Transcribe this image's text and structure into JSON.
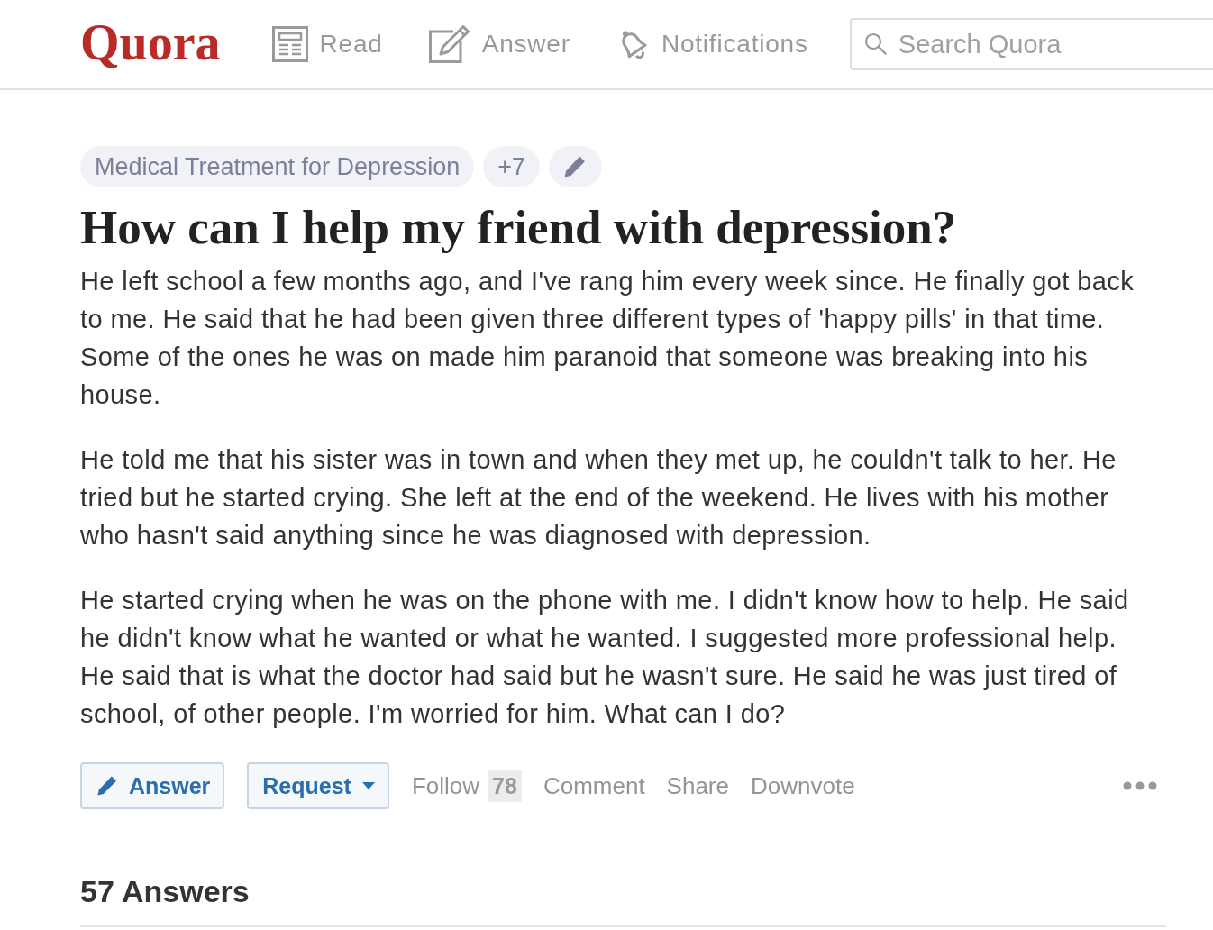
{
  "header": {
    "logo": "Quora",
    "nav": [
      {
        "kind": "read",
        "label": "Read",
        "selected": false
      },
      {
        "kind": "answer",
        "label": "Answer",
        "selected": false
      },
      {
        "kind": "notifications",
        "label": "Notifications",
        "selected": false
      }
    ],
    "search": {
      "placeholder": "Search Quora"
    }
  },
  "question": {
    "topics": [
      "Medical Treatment for Depression"
    ],
    "more_topics": "+7",
    "title": "How can I help my friend with depression?",
    "details": [
      "He left school a few months ago, and I've rang him every week since. He finally got back to me. He said that he had been given three different types of 'happy pills' in that time. Some of the ones he was on made him paranoid that someone was breaking into his house.",
      "He told me that his sister was in town and when they met up, he couldn't talk to her. He tried but he started crying. She left at the end of the weekend. He lives with his mother who hasn't said anything since he was diagnosed with depression.",
      "He started crying when he was on the phone with me. I didn't know how to help. He said he didn't know what he wanted or what he wanted. I suggested more professional help. He said that is what the doctor had said but he wasn't sure. He said he was just tired of school, of other people. I'm worried for him. What can I do?"
    ]
  },
  "actions": {
    "answer": "Answer",
    "request": "Request",
    "follow": "Follow",
    "follow_count": "78",
    "links": [
      "Comment",
      "Share",
      "Downvote"
    ]
  },
  "answers_heading": "57 Answers"
}
